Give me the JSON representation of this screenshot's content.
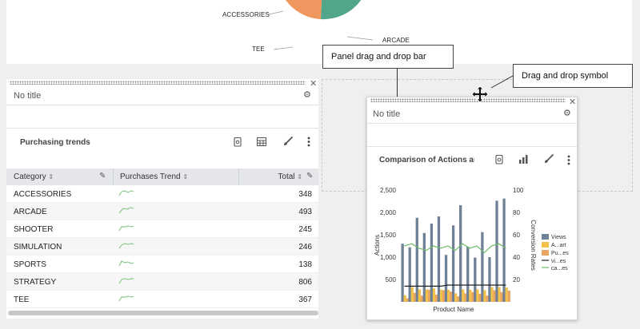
{
  "top_panel": {
    "pie_labels": [
      "ACCESSORIES",
      "TEE",
      "ARCADE"
    ],
    "pie_colors": {
      "tee": "#f0975f",
      "arcade": "#50a58a",
      "accessories": "#b85760",
      "blue": "#2b70a8"
    }
  },
  "left_panel": {
    "title": "No title",
    "viz_title": "Purchasing trends",
    "columns": [
      {
        "label": "Category",
        "sort": "⇕"
      },
      {
        "label": "Purchases Trend",
        "sort": "⇕"
      },
      {
        "label": "Total",
        "sort": "⇕"
      }
    ],
    "rows": [
      {
        "category": "ACCESSORIES",
        "total": "348"
      },
      {
        "category": "ARCADE",
        "total": "493"
      },
      {
        "category": "SHOOTER",
        "total": "245"
      },
      {
        "category": "SIMULATION",
        "total": "246"
      },
      {
        "category": "SPORTS",
        "total": "138"
      },
      {
        "category": "STRATEGY",
        "total": "806"
      },
      {
        "category": "TEE",
        "total": "367"
      }
    ]
  },
  "callouts": {
    "drag_bar": "Panel drag and drop bar",
    "drag_symbol": "Drag and drop symbol"
  },
  "right_panel": {
    "title": "No title",
    "viz_title": "Comparison of Actions and Conversion Rates"
  },
  "chart_data": {
    "type": "bar",
    "xlabel": "Product Name",
    "ylabel": "Actions",
    "y2label": "Conversion Rates",
    "ylim": [
      0,
      2500
    ],
    "y2lim": [
      0,
      100
    ],
    "y_ticks": [
      "2,500",
      "2,000",
      "1,500",
      "1,000",
      "500"
    ],
    "y2_ticks": [
      "100",
      "80",
      "60",
      "40",
      "20"
    ],
    "legend_position": "right",
    "series": [
      {
        "name": "Views",
        "kind": "bar",
        "color": "#6f8196",
        "values": [
          1300,
          1220,
          1880,
          1540,
          1750,
          1910,
          1050,
          1710,
          2160,
          1230,
          990,
          1560,
          1000,
          2260,
          2310
        ]
      },
      {
        "name": "A...art",
        "kind": "bar",
        "color": "#f2c24a",
        "values": [
          150,
          330,
          280,
          280,
          300,
          270,
          270,
          190,
          280,
          270,
          280,
          260,
          330,
          330,
          320
        ]
      },
      {
        "name": "Pu...es",
        "kind": "bar",
        "color": "#e8a564",
        "values": [
          80,
          200,
          140,
          270,
          160,
          260,
          230,
          120,
          190,
          220,
          180,
          140,
          260,
          220,
          250
        ]
      },
      {
        "name": "vi...es",
        "kind": "line",
        "axis": "right",
        "color": "#222222",
        "values": [
          14,
          14,
          14,
          14,
          14,
          14,
          15,
          15,
          15,
          15,
          15,
          15,
          15,
          15,
          15
        ]
      },
      {
        "name": "ca...es",
        "kind": "line",
        "axis": "right",
        "color": "#6dbb6a",
        "values": [
          50,
          52,
          48,
          46,
          50,
          48,
          50,
          46,
          52,
          48,
          50,
          44,
          50,
          52,
          48
        ]
      }
    ]
  }
}
